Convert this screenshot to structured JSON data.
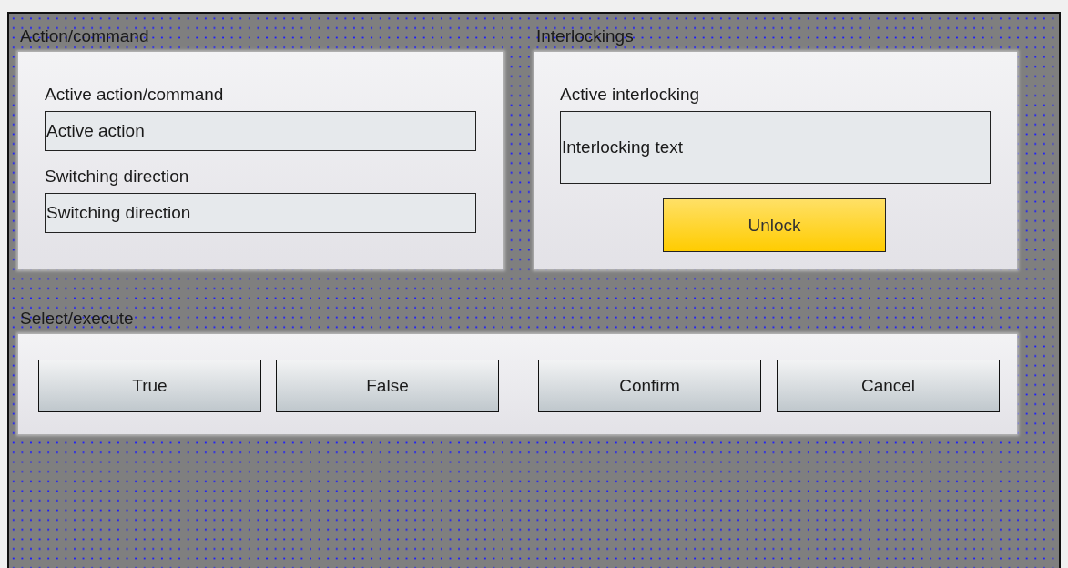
{
  "action_command": {
    "title": "Action/command",
    "fields": [
      {
        "label": "Active action/command",
        "value": "Active action"
      },
      {
        "label": "Switching direction",
        "value": "Switching direction"
      }
    ]
  },
  "interlockings": {
    "title": "Interlockings",
    "label": "Active interlocking",
    "value": "Interlocking text",
    "button": "Unlock"
  },
  "select_execute": {
    "title": "Select/execute",
    "buttons": [
      {
        "label": "True"
      },
      {
        "label": "False"
      },
      {
        "label": "Confirm"
      },
      {
        "label": "Cancel"
      }
    ]
  }
}
